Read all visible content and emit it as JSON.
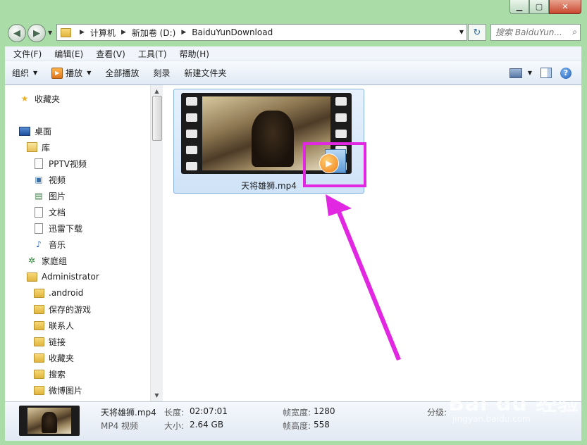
{
  "address": {
    "crumbs": [
      "计算机",
      "新加卷 (D:)",
      "BaiduYunDownload"
    ]
  },
  "search": {
    "placeholder": "搜索 BaiduYun..."
  },
  "menu": [
    "文件(F)",
    "编辑(E)",
    "查看(V)",
    "工具(T)",
    "帮助(H)"
  ],
  "toolbar": {
    "organize": "组织",
    "play": "播放",
    "play_all": "全部播放",
    "burn": "刻录",
    "new_folder": "新建文件夹"
  },
  "nav": {
    "favorites": "收藏夹",
    "desktop": "桌面",
    "library": "库",
    "pptv": "PPTV视频",
    "videos": "视频",
    "pictures": "图片",
    "documents": "文档",
    "thunder": "迅雷下载",
    "music": "音乐",
    "homegroup": "家庭组",
    "administrator": "Administrator",
    "android": ".android",
    "saved_games": "保存的游戏",
    "contacts": "联系人",
    "links": "链接",
    "favorites2": "收藏夹",
    "searches": "搜索",
    "weibo_pics": "微博图片"
  },
  "file": {
    "name": "天将雄狮.mp4"
  },
  "details": {
    "name": "天将雄狮.mp4",
    "type": "MP4 视频",
    "length_label": "长度:",
    "length": "02:07:01",
    "size_label": "大小:",
    "size": "2.64 GB",
    "width_label": "帧宽度:",
    "width": "1280",
    "height_label": "帧高度:",
    "height": "558",
    "rating_label": "分级:"
  },
  "watermark": {
    "main": "Bai du 经验",
    "sub": "jingyan.baidu.com"
  },
  "colors": {
    "highlight": "#e227e2",
    "frame": "#a9dca7",
    "selection": "#cfe3f8"
  }
}
